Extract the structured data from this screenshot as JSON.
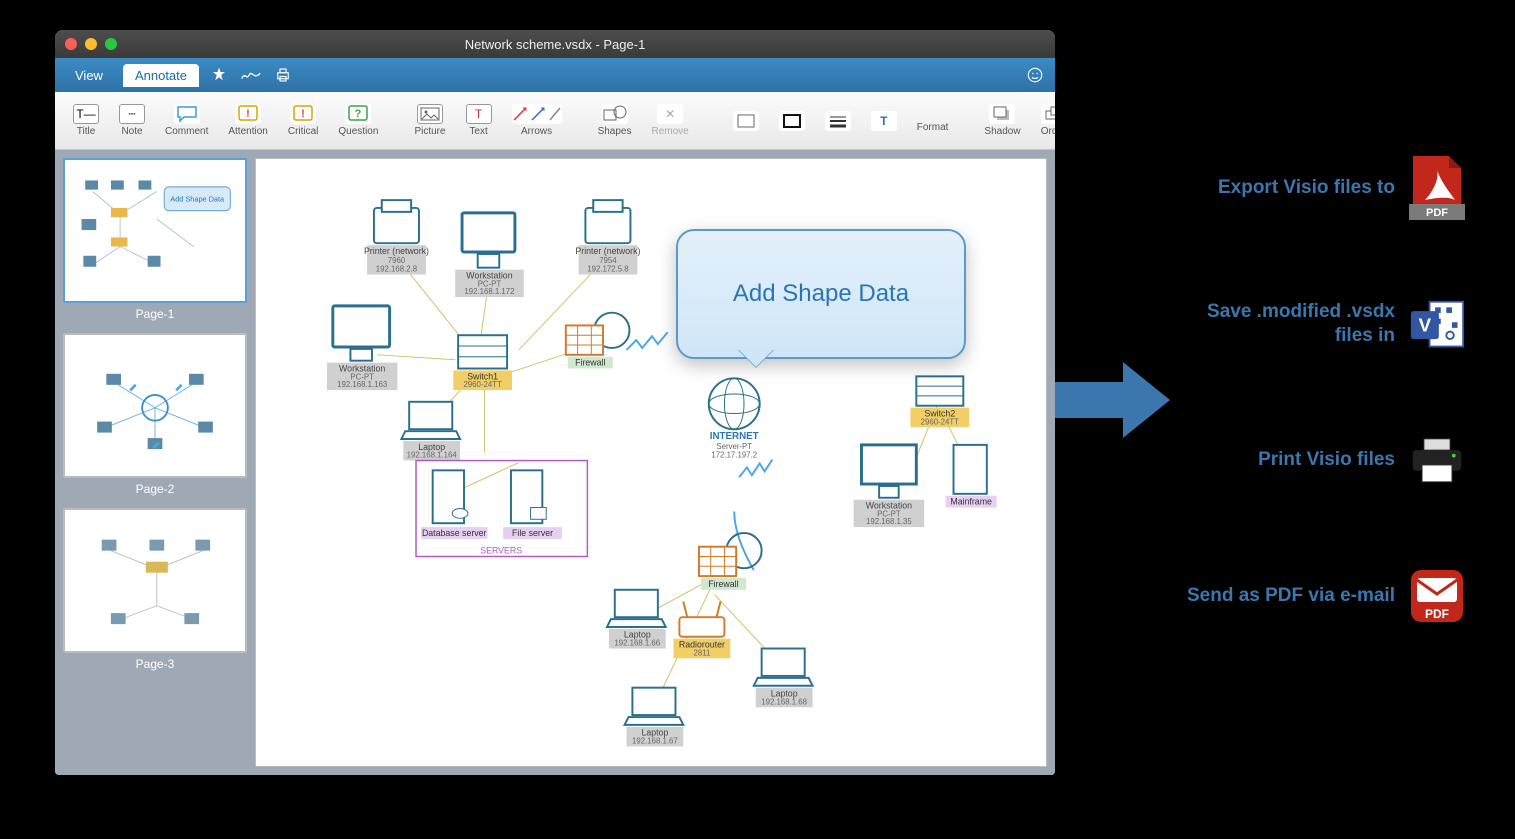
{
  "window": {
    "title": "Network scheme.vsdx - Page-1"
  },
  "menubar": {
    "tabs": {
      "view": "View",
      "annotate": "Annotate"
    }
  },
  "toolbar": {
    "title": "Title",
    "note": "Note",
    "comment": "Comment",
    "attention": "Attention",
    "critical": "Critical",
    "question": "Question",
    "picture": "Picture",
    "text": "Text",
    "arrows": "Arrows",
    "shapes": "Shapes",
    "remove": "Remove",
    "format": "Format",
    "shadow": "Shadow",
    "order": "Order"
  },
  "sidebar": {
    "pages": [
      {
        "label": "Page-1"
      },
      {
        "label": "Page-2"
      },
      {
        "label": "Page-3"
      }
    ]
  },
  "callout": {
    "text": "Add Shape Data"
  },
  "diagram": {
    "printer1": {
      "name": "Printer (network)",
      "id": "7960",
      "ip": "192.168.2.8"
    },
    "printer2": {
      "name": "Printer (network)",
      "id": "7954",
      "ip": "192.172.5.8"
    },
    "ws1": {
      "name": "Workstation",
      "sub": "PC-PT",
      "ip": "192.168.1.172"
    },
    "ws2": {
      "name": "Workstation",
      "sub": "PC-PT",
      "ip": "192.168.1.163"
    },
    "ws3": {
      "name": "Workstation",
      "sub": "PC-PT",
      "ip": "192.168.1.35"
    },
    "switch1": {
      "name": "Switch1",
      "model": "2960-24TT"
    },
    "switch2": {
      "name": "Switch2",
      "model": "2960-24TT"
    },
    "firewall1": {
      "name": "Firewall"
    },
    "firewall2": {
      "name": "Firewall"
    },
    "laptop1": {
      "name": "Laptop",
      "ip": "192.168.1.164"
    },
    "laptop2": {
      "name": "Laptop",
      "ip": "192.168.1.66"
    },
    "laptop3": {
      "name": "Laptop",
      "ip": "192.168.1.67"
    },
    "laptop4": {
      "name": "Laptop",
      "ip": "192.168.1.68"
    },
    "dbserver": {
      "name": "Database server"
    },
    "fileserver": {
      "name": "File server"
    },
    "serversGroup": "SERVERS",
    "internet": {
      "name": "INTERNET",
      "sub": "Server-PT",
      "ip": "172.17.197.2"
    },
    "radiorouter": {
      "name": "Radiorouter",
      "model": "2811"
    },
    "mainframe": {
      "name": "Mainframe"
    }
  },
  "features": {
    "export": "Export Visio files to",
    "save": "Save .modified .vsdx files in",
    "print": "Print Visio files",
    "send": "Send as PDF via e-mail"
  },
  "icons": {
    "pdf": "PDF"
  },
  "thumb_callout": "Add Shape Data"
}
